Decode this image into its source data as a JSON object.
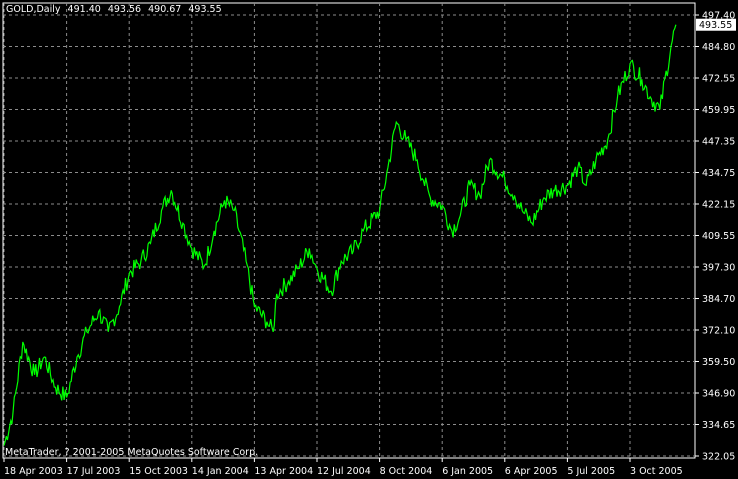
{
  "header": {
    "symbol": "GOLD,Daily",
    "open": "491.40",
    "high": "493.56",
    "low": "490.67",
    "close": "493.55"
  },
  "footer": {
    "copyright": "MetaTrader, ? 2001-2005 MetaQuotes Software Corp."
  },
  "colors": {
    "background": "#000000",
    "frame": "#ffffff",
    "grid": "#8c8c8c",
    "line": "#00ff00",
    "text": "#ffffff"
  },
  "chart_data": {
    "type": "line",
    "ylim": [
      322.05,
      497.4
    ],
    "grid": true,
    "ytick_labels": [
      "497.40",
      "484.80",
      "472.55",
      "459.95",
      "447.35",
      "434.75",
      "422.15",
      "409.55",
      "397.30",
      "384.70",
      "372.10",
      "359.50",
      "346.90",
      "334.65",
      "322.05"
    ],
    "xtick_labels": [
      "18 Apr 2003",
      "17 Jul 2003",
      "15 Oct 2003",
      "14 Jan 2004",
      "13 Apr 2004",
      "12 Jul 2004",
      "8 Oct 2004",
      "6 Jan 2005",
      "6 Apr 2005",
      "5 Jul 2005",
      "3 Oct 2005"
    ],
    "last_price_label": "493.55",
    "series": [
      {
        "x": [
          "2003-04-18",
          "2003-05-01",
          "2003-05-15",
          "2003-06-01",
          "2003-06-15",
          "2003-07-01",
          "2003-07-17",
          "2003-08-01",
          "2003-08-15",
          "2003-09-01",
          "2003-09-15",
          "2003-10-01",
          "2003-10-15",
          "2003-11-01",
          "2003-11-15",
          "2003-12-01",
          "2003-12-15",
          "2004-01-01",
          "2004-01-14",
          "2004-02-01",
          "2004-02-15",
          "2004-03-01",
          "2004-03-15",
          "2004-04-01",
          "2004-04-13",
          "2004-05-01",
          "2004-05-10",
          "2004-05-15",
          "2004-06-01",
          "2004-06-15",
          "2004-07-01",
          "2004-07-12",
          "2004-08-01",
          "2004-08-15",
          "2004-09-01",
          "2004-09-15",
          "2004-10-08",
          "2004-10-20",
          "2004-11-01",
          "2004-11-15",
          "2004-12-01",
          "2004-12-10",
          "2004-12-20",
          "2005-01-06",
          "2005-01-20",
          "2005-02-01",
          "2005-02-15",
          "2005-03-01",
          "2005-03-15",
          "2005-04-06",
          "2005-04-20",
          "2005-05-01",
          "2005-05-15",
          "2005-06-01",
          "2005-06-15",
          "2005-07-05",
          "2005-07-20",
          "2005-08-01",
          "2005-08-15",
          "2005-09-01",
          "2005-09-15",
          "2005-10-03",
          "2005-10-20",
          "2005-11-01",
          "2005-11-15",
          "2005-12-01",
          "2005-12-08"
        ],
        "values": [
          327,
          340,
          368,
          355,
          362,
          350,
          346,
          362,
          372,
          380,
          372,
          382,
          395,
          400,
          407,
          420,
          428,
          415,
          405,
          398,
          412,
          424,
          420,
          400,
          382,
          376,
          372,
          387,
          392,
          397,
          405,
          397,
          388,
          400,
          404,
          412,
          420,
          437,
          455,
          448,
          440,
          432,
          425,
          422,
          412,
          418,
          430,
          426,
          440,
          432,
          426,
          420,
          415,
          425,
          428,
          430,
          437,
          430,
          440,
          448,
          465,
          478,
          472,
          465,
          460,
          485,
          493.55
        ]
      }
    ]
  }
}
